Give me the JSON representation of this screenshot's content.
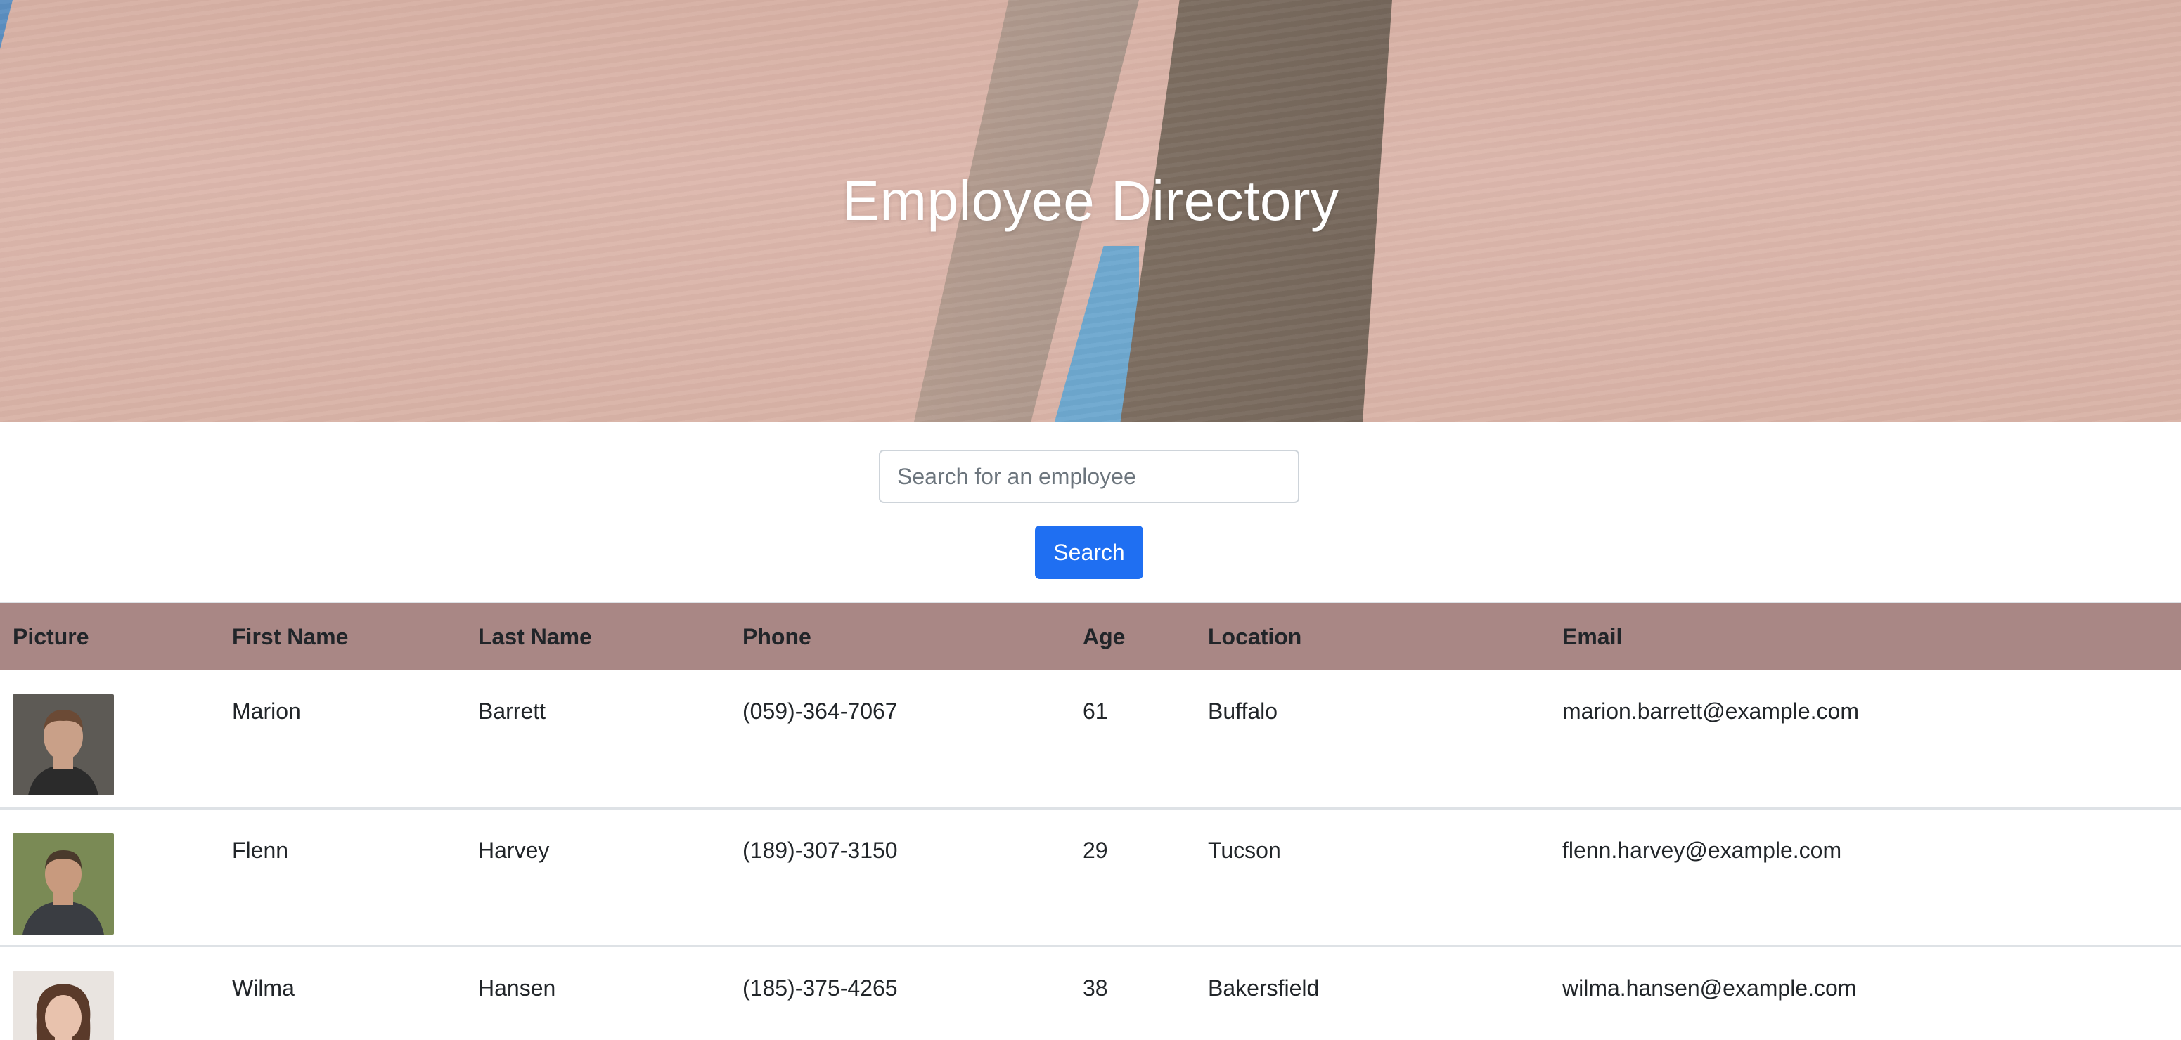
{
  "header": {
    "title": "Employee Directory"
  },
  "search": {
    "placeholder": "Search for an employee",
    "value": "",
    "button_label": "Search"
  },
  "table": {
    "columns": [
      "Picture",
      "First Name",
      "Last Name",
      "Phone",
      "Age",
      "Location",
      "Email"
    ],
    "rows": [
      {
        "first_name": "Marion",
        "last_name": "Barrett",
        "phone": "(059)-364-7067",
        "age": "61",
        "location": "Buffalo",
        "email": "marion.barrett@example.com",
        "avatar_colors": {
          "bg": "#5d5a55",
          "skin": "#c9a088",
          "hair": "#6b4a35",
          "shirt": "#2b2b2b"
        }
      },
      {
        "first_name": "Flenn",
        "last_name": "Harvey",
        "phone": "(189)-307-3150",
        "age": "29",
        "location": "Tucson",
        "email": "flenn.harvey@example.com",
        "avatar_colors": {
          "bg": "#7a8a55",
          "skin": "#c89a7e",
          "hair": "#4a3a2c",
          "shirt": "#3a3d42"
        }
      },
      {
        "first_name": "Wilma",
        "last_name": "Hansen",
        "phone": "(185)-375-4265",
        "age": "38",
        "location": "Bakersfield",
        "email": "wilma.hansen@example.com",
        "avatar_colors": {
          "bg": "#e9e4e0",
          "skin": "#e8c2ad",
          "hair": "#5a3a2a",
          "shirt": "#c8324a"
        }
      }
    ]
  },
  "colors": {
    "accent": "#1f6ff2",
    "table_header_bg": "#a98785",
    "hero_bg": "#d9b3a7"
  }
}
